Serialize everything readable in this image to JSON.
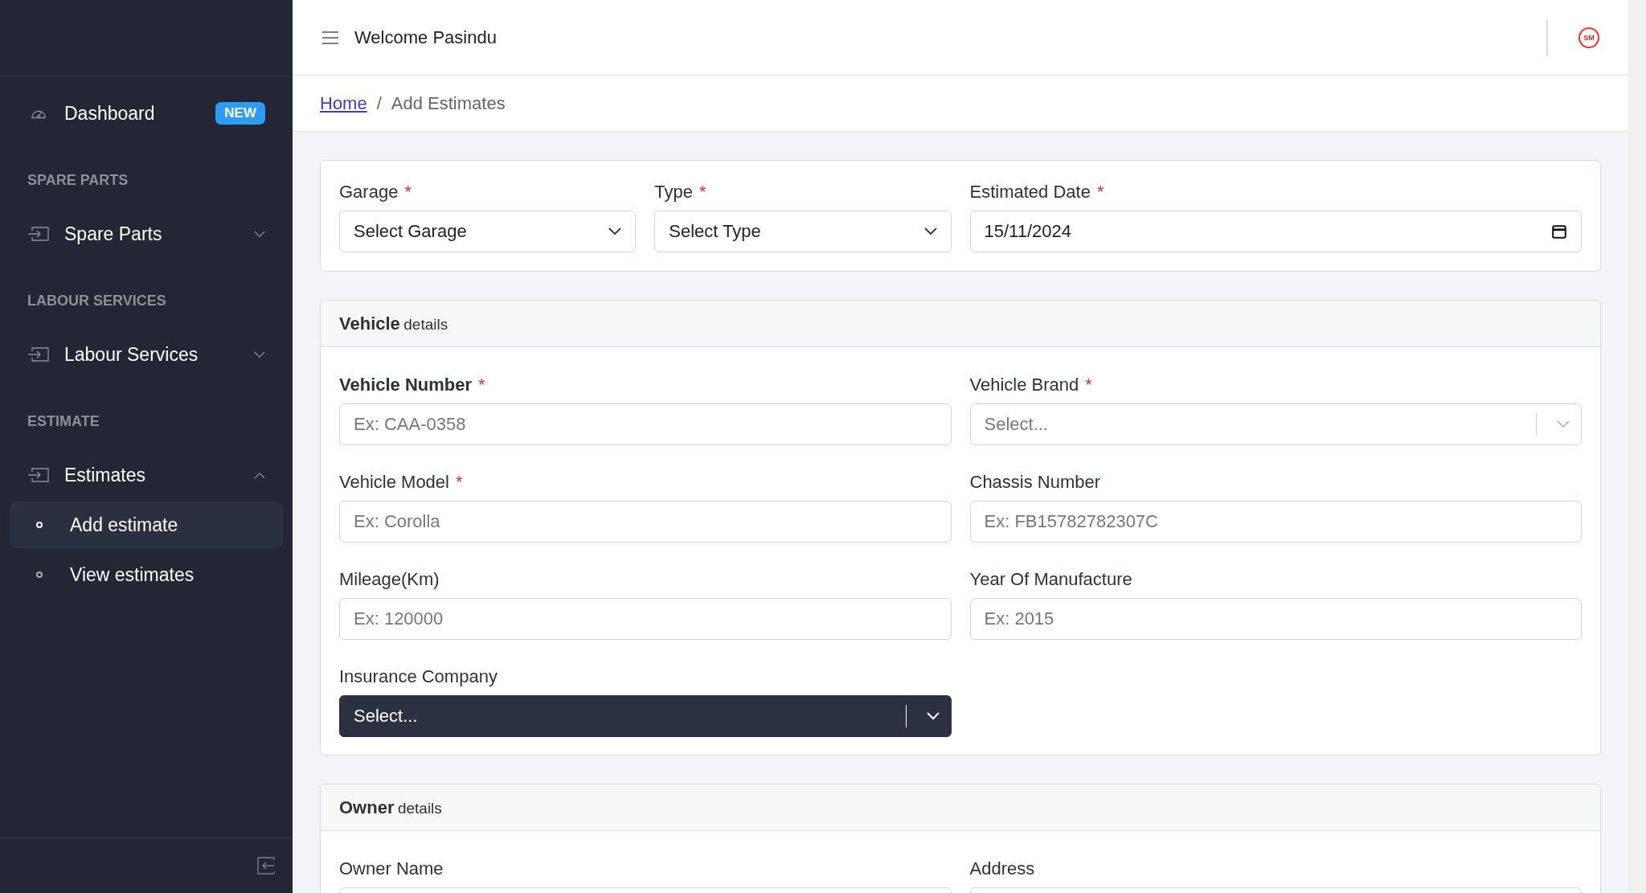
{
  "header": {
    "welcome": "Welcome Pasindu",
    "logo_text": "SM"
  },
  "sidebar": {
    "items": [
      {
        "kind": "link",
        "label": "Dashboard",
        "badge": "NEW"
      },
      {
        "kind": "section",
        "label": "SPARE PARTS"
      },
      {
        "kind": "group",
        "label": "Spare Parts",
        "expanded": false
      },
      {
        "kind": "section",
        "label": "LABOUR SERVICES"
      },
      {
        "kind": "group",
        "label": "Labour Services",
        "expanded": false
      },
      {
        "kind": "section",
        "label": "ESTIMATE"
      },
      {
        "kind": "group",
        "label": "Estimates",
        "expanded": true,
        "children": [
          {
            "label": "Add estimate",
            "selected": true
          },
          {
            "label": "View estimates",
            "selected": false
          }
        ]
      }
    ]
  },
  "breadcrumb": {
    "separator": "/",
    "items": [
      {
        "label": "Home",
        "link": true
      },
      {
        "label": "Add Estimates",
        "link": false
      }
    ]
  },
  "top_fields": [
    {
      "label": "Garage",
      "mark": "*",
      "kind": "select",
      "value": "Select Garage"
    },
    {
      "label": "Type",
      "mark": "*",
      "kind": "select",
      "value": "Select Type"
    },
    {
      "label": "Estimated Date",
      "mark": "*",
      "kind": "date",
      "value": "15/11/2024"
    }
  ],
  "sections": [
    {
      "title": "Vehicle",
      "subtitle": "details",
      "fields": [
        {
          "label": "Vehicle Number",
          "mark": "*",
          "bold": true,
          "kind": "text",
          "placeholder": "Ex: CAA-0358"
        },
        {
          "label": "Vehicle Brand",
          "mark": "*",
          "bold": false,
          "kind": "combo",
          "placeholder": "Select..."
        },
        {
          "label": "Vehicle Model",
          "mark": "*",
          "bold": false,
          "kind": "text",
          "placeholder": "Ex: Corolla"
        },
        {
          "label": "Chassis Number",
          "bold": false,
          "kind": "text",
          "placeholder": "Ex: FB15782782307C"
        },
        {
          "label": "Mileage(Km)",
          "bold": false,
          "kind": "text",
          "placeholder": "Ex: 120000"
        },
        {
          "label": "Year Of Manufacture",
          "bold": false,
          "kind": "text",
          "placeholder": "Ex: 2015"
        },
        {
          "label": "Insurance Company",
          "bold": false,
          "kind": "combo_dark",
          "placeholder": "Select..."
        }
      ]
    },
    {
      "title": "Owner",
      "subtitle": "details",
      "fields": [
        {
          "label": "Owner Name",
          "bold": false,
          "kind": "text"
        },
        {
          "label": "Address",
          "bold": false,
          "kind": "text"
        }
      ]
    }
  ]
}
